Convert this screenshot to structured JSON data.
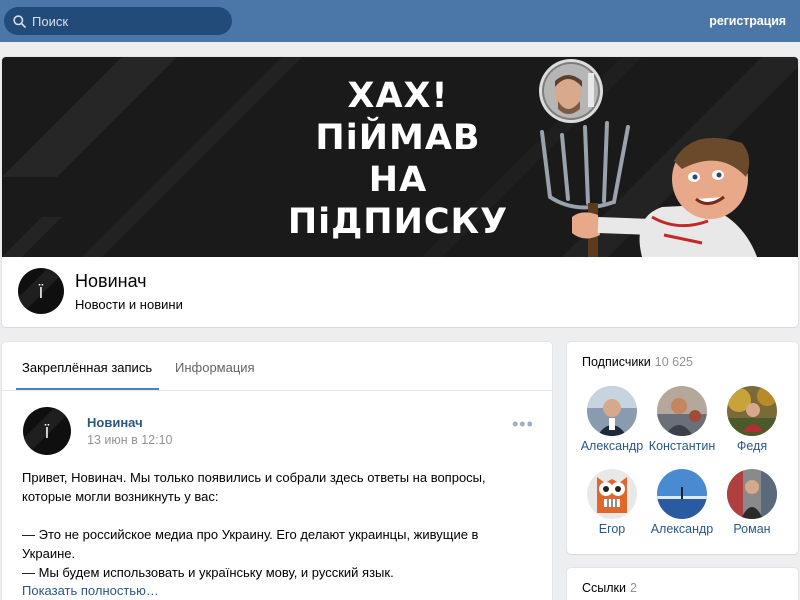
{
  "topbar": {
    "search_placeholder": "Поиск",
    "register_label": "регистрация"
  },
  "cover": {
    "title_lines": [
      "ХАХ!",
      "ПіЙМАВ",
      "НА",
      "ПіДПИСКУ"
    ]
  },
  "group": {
    "name": "Новинач",
    "status": "Новости и новини",
    "avatar_glyph": "Ї"
  },
  "tabs": {
    "pinned": "Закреплённая запись",
    "info": "Информация"
  },
  "post": {
    "author": "Новинач",
    "date": "13 июн в 12:10",
    "menu_glyph": "•••",
    "lines": [
      "Привет, Новинач. Мы только появились и собрали здесь ответы на вопросы,",
      "которые могли возникнуть у вас:",
      "— Это не российское медиа про Украину. Его делают украинцы, живущие в",
      "Украине.",
      "— Мы будем использовать и українську мову, и русский язык."
    ],
    "show_more": "Показать полностью…"
  },
  "subscribers": {
    "title": "Подписчики",
    "count": "10 625",
    "people": [
      {
        "name": "Александр"
      },
      {
        "name": "Константин"
      },
      {
        "name": "Федя"
      },
      {
        "name": "Егор"
      },
      {
        "name": "Александр"
      },
      {
        "name": "Роман"
      }
    ]
  },
  "links": {
    "title": "Ссылки",
    "count": "2"
  },
  "colors": {
    "header": "#4a76a8",
    "search_bg": "#224b7a",
    "link": "#2a5885",
    "page_bg": "#edeef0"
  }
}
